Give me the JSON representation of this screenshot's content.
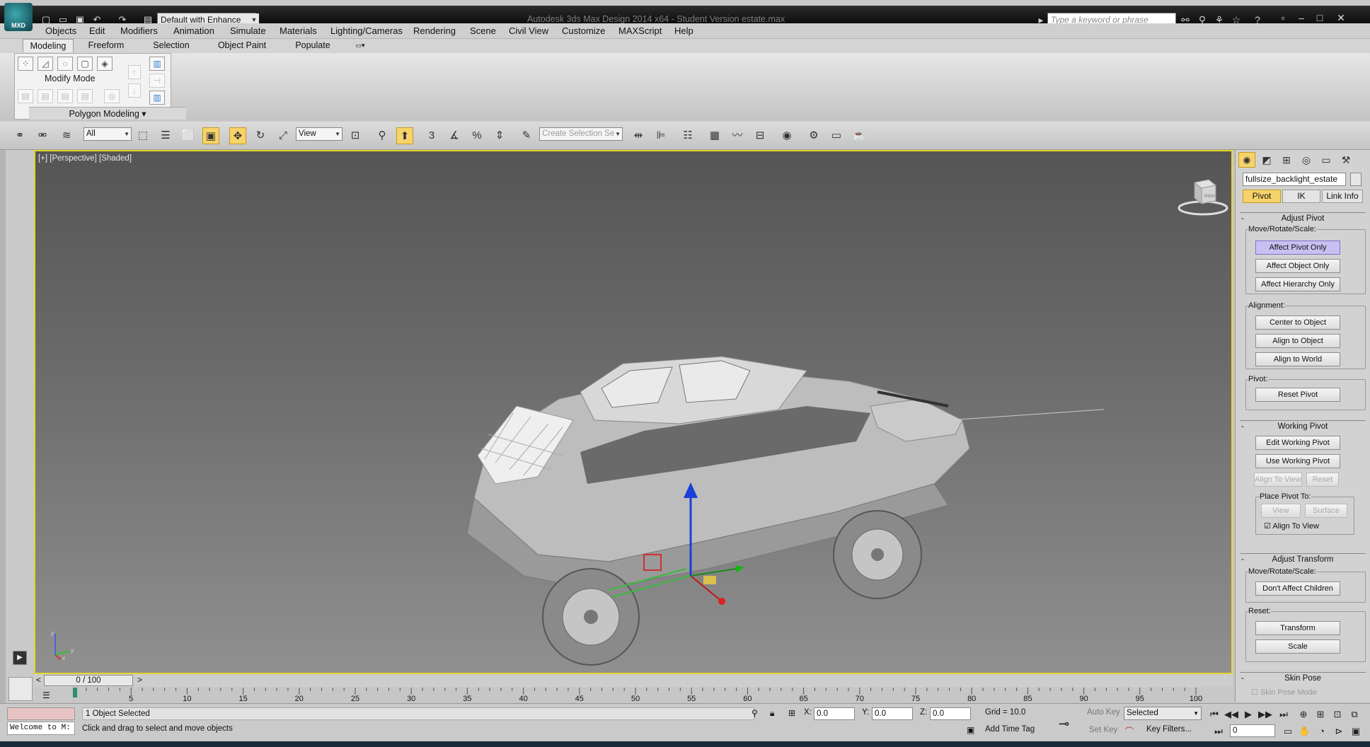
{
  "titlebar": {
    "logo_text": "MXD",
    "workspace": "Default with Enhance",
    "title": "Autodesk 3ds Max Design 2014 x64 - Student Version   estate.max",
    "search_placeholder": "Type a keyword or phrase"
  },
  "menu": [
    "Objects",
    "Edit",
    "Modifiers",
    "Animation",
    "Simulate",
    "Materials",
    "Lighting/Cameras",
    "Rendering",
    "Scene",
    "Civil View",
    "Customize",
    "MAXScript",
    "Help"
  ],
  "ribbon": {
    "tabs": [
      "Modeling",
      "Freeform",
      "Selection",
      "Object Paint",
      "Populate"
    ],
    "active_tab": "Modeling",
    "modify_mode": "Modify Mode",
    "polygon_modeling": "Polygon Modeling"
  },
  "toolbar": {
    "selection_filter": "All",
    "ref_coord": "View",
    "snap_label": "3",
    "selection_set_placeholder": "Create Selection Se"
  },
  "viewport": {
    "label": "[+] [Perspective] [Shaded]",
    "cube_face": "RIGHT"
  },
  "command_panel": {
    "object_name": "fullsize_backlight_estate",
    "tabs": [
      "Pivot",
      "IK",
      "Link Info"
    ],
    "adjust_pivot": "Adjust Pivot",
    "move_rotate_scale": "Move/Rotate/Scale:",
    "affect_pivot_only": "Affect Pivot Only",
    "affect_object_only": "Affect Object Only",
    "affect_hierarchy_only": "Affect Hierarchy Only",
    "alignment": "Alignment:",
    "center_to_object": "Center to Object",
    "align_to_object": "Align to Object",
    "align_to_world": "Align to World",
    "pivot": "Pivot:",
    "reset_pivot": "Reset Pivot",
    "working_pivot": "Working Pivot",
    "edit_working_pivot": "Edit Working Pivot",
    "use_working_pivot": "Use Working Pivot",
    "align_to_view_btn": "Align To View",
    "reset": "Reset",
    "place_pivot_to": "Place Pivot To:",
    "view": "View",
    "surface": "Surface",
    "align_to_view_check": "Align To View",
    "adjust_transform": "Adjust Transform",
    "move_rotate_scale2": "Move/Rotate/Scale:",
    "dont_affect_children": "Don't Affect Children",
    "reset_label": "Reset:",
    "transform": "Transform",
    "scale": "Scale",
    "skin_pose": "Skin Pose",
    "skin_pose_mode": "Skin Pose Mode"
  },
  "timeline": {
    "slider": "0 / 100",
    "ticks": [
      "5",
      "10",
      "15",
      "20",
      "25",
      "30",
      "35",
      "40",
      "45",
      "50",
      "55",
      "60",
      "65",
      "70",
      "75",
      "80",
      "85",
      "90",
      "95",
      "100"
    ]
  },
  "status": {
    "mini_script": "Welcome to M:",
    "selected_count": "1 Object Selected",
    "prompt": "Click and drag to select and move objects",
    "x_label": "X:",
    "x_value": "0.0",
    "y_label": "Y:",
    "y_value": "0.0",
    "z_label": "Z:",
    "z_value": "0.0",
    "grid": "Grid = 10.0",
    "add_time_tag": "Add Time Tag",
    "auto_key": "Auto Key",
    "set_key": "Set Key",
    "key_mode": "Selected",
    "key_filters": "Key Filters...",
    "frame": "0"
  }
}
